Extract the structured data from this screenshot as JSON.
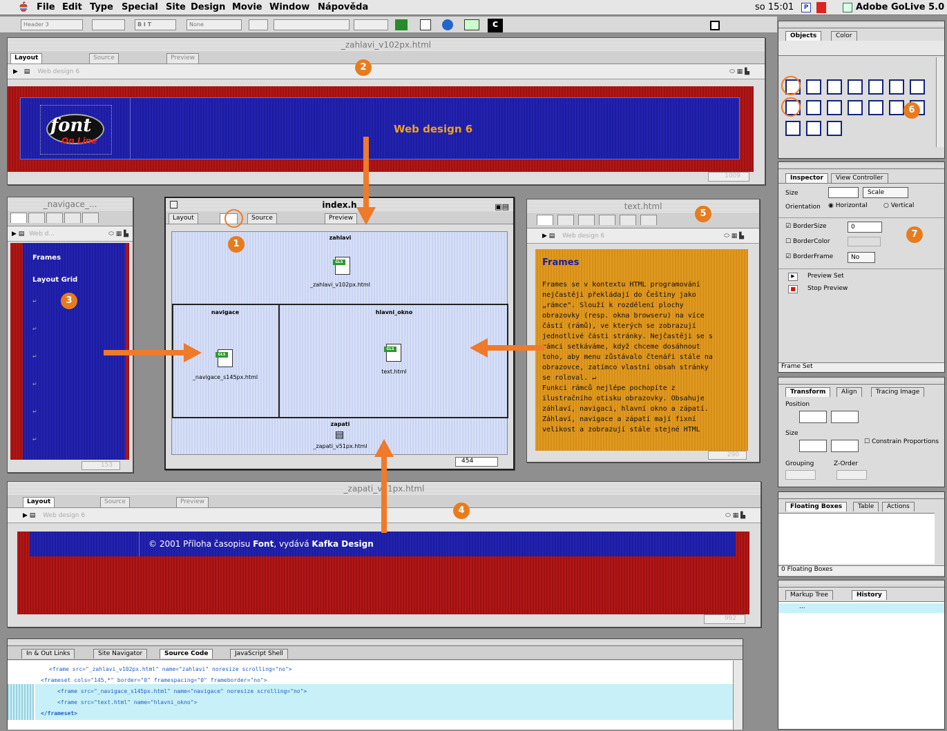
{
  "menubar": {
    "items": [
      "File",
      "Edit",
      "Type",
      "Special",
      "Site",
      "Design",
      "Movie",
      "Window",
      "Nápověda"
    ],
    "clock": "so 15:01",
    "app_name": "Adobe GoLive 5.0"
  },
  "toolbar": {
    "paragraph_format": "Header 3",
    "font_select": "None"
  },
  "window_header": {
    "title": "_zahlavi_v102px.html",
    "tabs": [
      "Layout",
      "Source",
      "Preview"
    ],
    "page_title": "Web design 6",
    "banner_text": "Web design 6",
    "logo_main": "font",
    "logo_sub": "On Line",
    "width_readout": "1009"
  },
  "window_nav": {
    "title": "_navigace_...",
    "page_title": "Web d...",
    "items": [
      "Frames",
      "Layout Grid"
    ],
    "width_readout": "153"
  },
  "window_index": {
    "title": "index.h",
    "tabs": [
      "Layout",
      "Source",
      "Preview"
    ],
    "frames": {
      "top_label": "zahlavi",
      "top_file": "_zahlavi_v102px.html",
      "left_label": "navigace",
      "left_file": "_navigace_s145px.html",
      "main_label": "hlavni_okno",
      "main_file": "text.html",
      "bottom_label": "zapati",
      "bottom_file": "_zapati_v51px.html"
    },
    "width_readout": "454"
  },
  "window_text": {
    "title": "text.html",
    "page_title": "Web design 6",
    "heading": "Frames",
    "body_lines": [
      "Frames se v kontextu HTML programování",
      "nejčastěji překládají do Češtiny jako",
      "„rámce\". Slouží k rozdělení plochy",
      "obrazovky (resp. okna browseru) na více",
      "částí (rámů), ve kterých se zobrazují",
      "jednotlivé části stránky. Nejčastěji se s",
      "rámci setkáváme, když chceme dosáhnout",
      "toho, aby menu zůstávalo čtenáři stále na",
      "obrazovce, zatímco vlastní obsah stránky",
      "se roloval. ↵",
      "Funkci rámců nejlépe pochopíte z",
      "ilustračního otisku obrazovky. Obsahuje",
      "záhlaví, navigaci, hlavní okno a zápatí.",
      "Záhlaví, navigace a zápatí mají fixní",
      "velikost a zobrazují stále stejné HTML"
    ],
    "width_readout": "290"
  },
  "window_footer": {
    "title": "_zapati_v51px.html",
    "tabs": [
      "Layout",
      "Source",
      "Preview"
    ],
    "page_title": "Web design 6",
    "copyright_prefix": "© 2001 Příloha časopisu ",
    "copyright_font": "Font",
    "copyright_middle": ", vydává ",
    "copyright_publisher": "Kafka Design",
    "width_readout": "992"
  },
  "objects_palette": {
    "tabs": [
      "Objects",
      "Color"
    ]
  },
  "inspector": {
    "tabs": [
      "Inspector",
      "View Controller"
    ],
    "size_label": "Size",
    "scale_option": "Scale",
    "orientation_label": "Orientation",
    "horizontal": "Horizontal",
    "vertical": "Vertical",
    "bordersize_label": "BorderSize",
    "bordersize_value": "0",
    "bordercolor_label": "BorderColor",
    "borderframe_label": "BorderFrame",
    "borderframe_value": "No",
    "preview_set": "Preview Set",
    "stop_preview": "Stop Preview",
    "status": "Frame Set"
  },
  "transform": {
    "tabs": [
      "Transform",
      "Align",
      "Tracing Image"
    ],
    "position_label": "Position",
    "size_label": "Size",
    "constrain_label": "Constrain Proportions",
    "grouping_label": "Grouping",
    "zorder_label": "Z-Order"
  },
  "floating": {
    "tabs": [
      "Floating Boxes",
      "Table",
      "Actions"
    ],
    "status": "0 Floating Boxes"
  },
  "history": {
    "tabs": [
      "Markup Tree",
      "History"
    ],
    "item": "..."
  },
  "source_panel": {
    "tabs": [
      "In & Out Links",
      "Site Navigator",
      "Source Code",
      "JavaScript Shell"
    ],
    "lines": [
      "<frame src=\"_zahlavi_v102px.html\" name=\"zahlavi\" noresize scrolling=\"no\">",
      "<frameset cols=\"145,*\" border=\"0\" framespacing=\"0\" frameborder=\"no\">",
      "<frame src=\"_navigace_s145px.html\" name=\"navigace\" noresize scrolling=\"no\">",
      "<frame src=\"text.html\" name=\"hlavni_okno\">",
      "</frameset>"
    ]
  },
  "badges": [
    "1",
    "2",
    "3",
    "4",
    "5",
    "6",
    "7"
  ],
  "colors": {
    "accent": "#e77c1e",
    "banner_blue": "#1c1ca0",
    "banner_red": "#b01818",
    "text_bg": "#e09a20"
  }
}
